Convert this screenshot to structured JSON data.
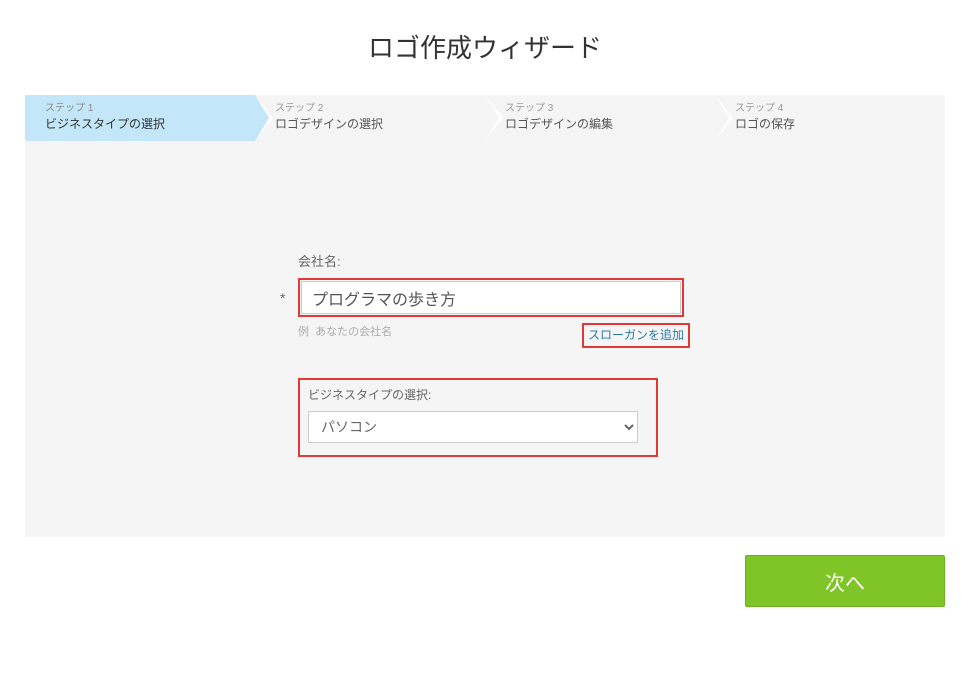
{
  "title": "ロゴ作成ウィザード",
  "steps": [
    {
      "number": "ステップ 1",
      "label": "ビジネスタイプの選択",
      "active": true
    },
    {
      "number": "ステップ 2",
      "label": "ロゴデザインの選択",
      "active": false
    },
    {
      "number": "ステップ 3",
      "label": "ロゴデザインの編集",
      "active": false
    },
    {
      "number": "ステップ 4",
      "label": "ロゴの保存",
      "active": false
    }
  ],
  "form": {
    "company_label": "会社名:",
    "asterisk": "*",
    "company_value": "プログラマの歩き方",
    "example_prefix": "例",
    "example_text": "あなたの会社名",
    "slogan_link": "スローガンを追加",
    "business_type_label": "ビジネスタイプの選択:",
    "business_type_value": "パソコン"
  },
  "buttons": {
    "next": "次へ"
  }
}
